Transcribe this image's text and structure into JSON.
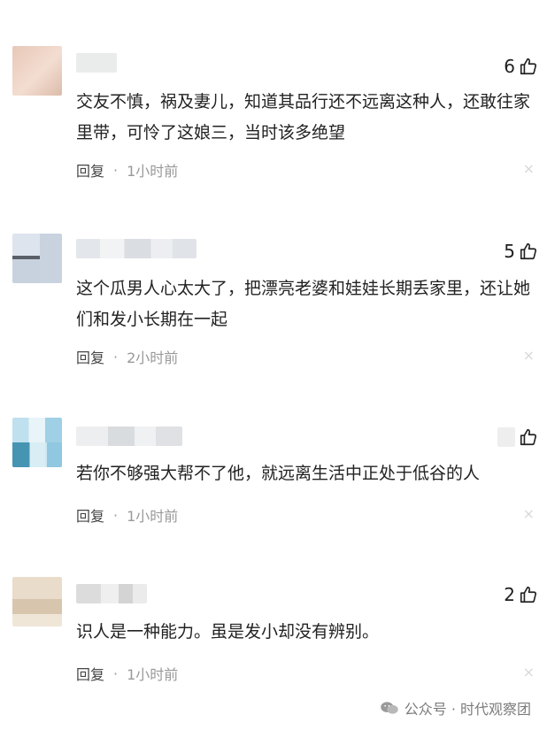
{
  "comments": [
    {
      "likes": "6",
      "text": "交友不慎，祸及妻儿，知道其品行还不远离这种人，还敢往家里带，可怜了这娘三，当时该多绝望",
      "reply_label": "回复",
      "separator": "·",
      "time": "1小时前",
      "close_glyph": "×"
    },
    {
      "likes": "5",
      "text": "这个瓜男人心太大了，把漂亮老婆和娃娃长期丢家里，还让她们和发小长期在一起",
      "reply_label": "回复",
      "separator": "·",
      "time": "2小时前",
      "close_glyph": "×"
    },
    {
      "likes": "",
      "text": "若你不够强大帮不了他，就远离生活中正处于低谷的人",
      "reply_label": "回复",
      "separator": "·",
      "time": "1小时前",
      "close_glyph": "×"
    },
    {
      "likes": "2",
      "text": "识人是一种能力。虽是发小却没有辨别。",
      "reply_label": "回复",
      "separator": "·",
      "time": "1小时前",
      "close_glyph": "×"
    }
  ],
  "watermark": {
    "text": "公众号 · 时代观察团",
    "icon": "wechat-icon"
  },
  "colors": {
    "text": "#222222",
    "meta": "#999999",
    "close": "#d8d8d8"
  }
}
